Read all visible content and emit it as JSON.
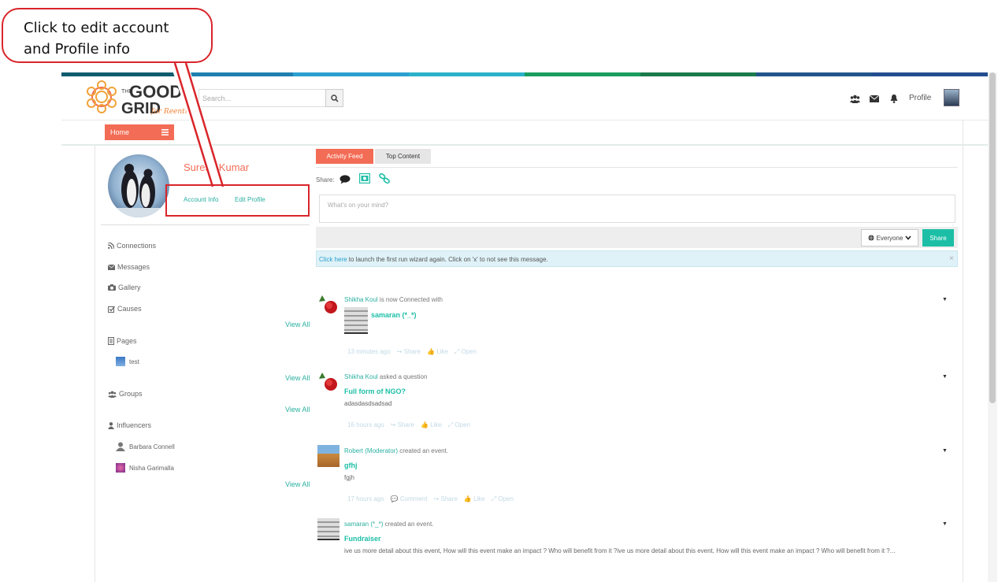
{
  "callout": {
    "line1": "Click to edit account",
    "line2": "and Profile info"
  },
  "header": {
    "search_placeholder": "Search...",
    "profile_label": "Profile",
    "stripe_colors": [
      "#0f5c6e",
      "#1f7fb0",
      "#2a9fd0",
      "#2bb1c9",
      "#1a9e5e",
      "#1b7a4c",
      "#22558a",
      "#244c8f"
    ]
  },
  "nav": {
    "home_label": "Home"
  },
  "profile": {
    "name": "Suresh Kumar",
    "account_info": "Account Info",
    "edit_profile": "Edit Profile"
  },
  "sidebar": {
    "connections": "Connections",
    "messages": "Messages",
    "gallery": "Gallery",
    "causes": "Causes",
    "view_all": "View All",
    "pages": "Pages",
    "page_item": "test",
    "groups": "Groups",
    "influencers": "Influencers",
    "influencer_1": "Barbara Connell",
    "influencer_2": "Nisha Garimalla"
  },
  "feed": {
    "tab_activity": "Activity Feed",
    "tab_top": "Top Content",
    "share_label": "Share:",
    "textarea_placeholder": "What's on your mind?",
    "everyone": "Everyone",
    "share_button": "Share",
    "info_link": "Click here",
    "info_text": " to launch the first run wizard again. Click on 'x' to not see this message.",
    "info_close": "×",
    "posts": [
      {
        "author": "Shikha Koul",
        "action": " is now Connected with",
        "title": "samaran (*_*)",
        "body": "",
        "time": "13 minutes ago",
        "actions": [
          "Share",
          "Like",
          "Open"
        ]
      },
      {
        "author": "Shikha Koul",
        "action": " asked a question",
        "title": "Full form of NGO?",
        "body": "adasdasdsadsad",
        "time": "16 hours ago",
        "actions": [
          "Share",
          "Like",
          "Open"
        ]
      },
      {
        "author": "Robert (Moderator)",
        "action": " created an event.",
        "title": "gfhj",
        "body": "fgjh",
        "time": "17 hours ago",
        "actions": [
          "Comment",
          "Share",
          "Like",
          "Open"
        ]
      },
      {
        "author": "samaran (*_*)",
        "action": " created an event.",
        "title": "Fundraiser",
        "body": "ive us more detail about this event, How will this event make an impact ? Who will benefit from it ?ive us more detail about this event, How will this event make an impact ? Who will benefit from it ?...",
        "time": "",
        "actions": []
      }
    ]
  }
}
